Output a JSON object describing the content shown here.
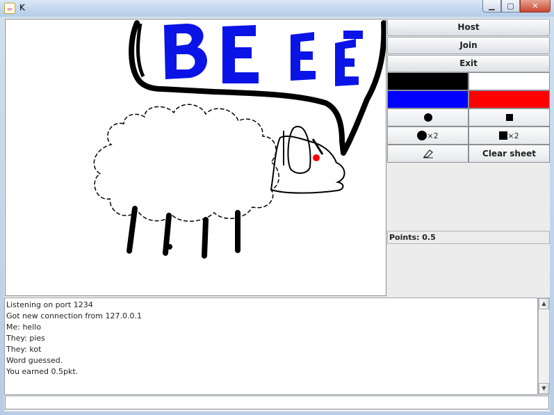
{
  "window": {
    "title": "K",
    "app_icon": "java-cup-icon",
    "controls": [
      "minimize-icon",
      "maximize-icon",
      "close-icon"
    ]
  },
  "canvas": {
    "speech_text": "BEEE",
    "colors": {
      "ink": "#000000",
      "blue": "#0000ff",
      "red": "#ff0000"
    }
  },
  "panel": {
    "host_label": "Host",
    "join_label": "Join",
    "exit_label": "Exit",
    "colors": [
      "#000000",
      "#ffffff",
      "#0000ff",
      "#ff0000"
    ],
    "tools": {
      "round_brush": "brush-round-icon",
      "square_brush": "brush-square-icon",
      "round_brush_x2": "×2",
      "square_brush_x2": "×2",
      "eraser": "eraser-icon",
      "clear_label": "Clear sheet"
    },
    "points_label": "Points: 0.5"
  },
  "log": [
    "Listening on port 1234",
    "Got new connection from 127.0.0.1",
    "Me: hello",
    "They: pies",
    "They: kot",
    "Word guessed.",
    "You earned 0.5pkt."
  ],
  "chat_input": {
    "value": ""
  }
}
